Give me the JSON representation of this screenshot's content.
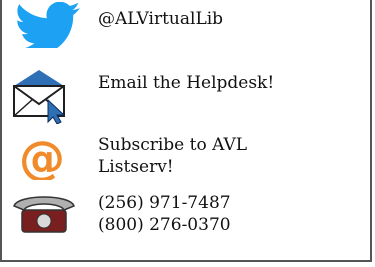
{
  "contacts": {
    "twitter": {
      "icon": "twitter-bird-icon",
      "label": "@ALVirtualLib",
      "color": "#1da1f2"
    },
    "email": {
      "icon": "envelope-cursor-icon",
      "label": "Email the Helpdesk!",
      "color": "#2f6fb5"
    },
    "listserv": {
      "icon": "at-sign-icon",
      "label_line1": "Subscribe to AVL",
      "label_line2": "Listserv!",
      "color": "#f08a2a"
    },
    "phone": {
      "icon": "telephone-icon",
      "number1": "(256) 971-7487",
      "number2": "(800) 276-0370",
      "color": "#7a1f1f"
    }
  }
}
